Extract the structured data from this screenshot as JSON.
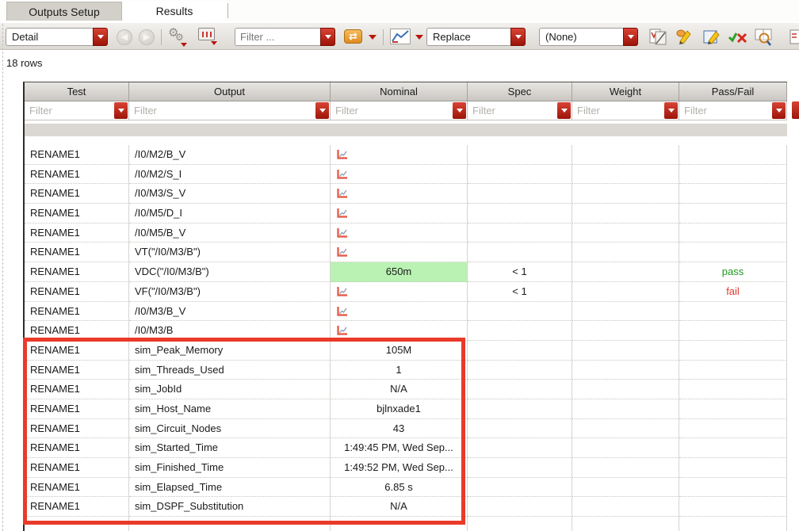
{
  "tabs": [
    {
      "label": "Outputs Setup",
      "active": false
    },
    {
      "label": "Results",
      "active": true
    }
  ],
  "toolbar": {
    "view_mode_combo": {
      "value": "Detail"
    },
    "filter_combo": {
      "placeholder": "Filter ..."
    },
    "plot_mode_combo": {
      "value": "Replace"
    },
    "refinement_combo": {
      "value": "(None)"
    },
    "icons": [
      "back-arrow-icon",
      "forward-arrow-icon",
      "settings-gears-icon",
      "waveform-window-icon",
      "swap-refresh-icon",
      "plot-chart-icon",
      "spec-editor-icon",
      "highlight-pencil-icon",
      "edit-notes-icon",
      "pass-fail-check-icon",
      "find-documents-icon",
      "clipped-document-icon"
    ]
  },
  "status": {
    "row_count_label": "18 rows"
  },
  "table": {
    "columns": [
      "Test",
      "Output",
      "Nominal",
      "Spec",
      "Weight",
      "Pass/Fail"
    ],
    "filter_placeholder": "Filter",
    "rows": [
      {
        "test": "RENAME1",
        "output": "/I0/M2/B_V",
        "nominal_icon": true,
        "nominal_text": "",
        "spec": "",
        "weight": "",
        "passfail": ""
      },
      {
        "test": "RENAME1",
        "output": "/I0/M2/S_I",
        "nominal_icon": true,
        "nominal_text": "",
        "spec": "",
        "weight": "",
        "passfail": ""
      },
      {
        "test": "RENAME1",
        "output": "/I0/M3/S_V",
        "nominal_icon": true,
        "nominal_text": "",
        "spec": "",
        "weight": "",
        "passfail": ""
      },
      {
        "test": "RENAME1",
        "output": "/I0/M5/D_I",
        "nominal_icon": true,
        "nominal_text": "",
        "spec": "",
        "weight": "",
        "passfail": ""
      },
      {
        "test": "RENAME1",
        "output": "/I0/M5/B_V",
        "nominal_icon": true,
        "nominal_text": "",
        "spec": "",
        "weight": "",
        "passfail": ""
      },
      {
        "test": "RENAME1",
        "output": "VT(\"/I0/M3/B\")",
        "nominal_icon": true,
        "nominal_text": "",
        "spec": "",
        "weight": "",
        "passfail": ""
      },
      {
        "test": "RENAME1",
        "output": "VDC(\"/I0/M3/B\")",
        "nominal_icon": false,
        "nominal_text": "650m",
        "nominal_highlight": true,
        "spec": "< 1",
        "weight": "",
        "passfail": "pass"
      },
      {
        "test": "RENAME1",
        "output": "VF(\"/I0/M3/B\")",
        "nominal_icon": true,
        "nominal_text": "",
        "spec": "< 1",
        "weight": "",
        "passfail": "fail"
      },
      {
        "test": "RENAME1",
        "output": "/I0/M3/B_V",
        "nominal_icon": true,
        "nominal_text": "",
        "spec": "",
        "weight": "",
        "passfail": ""
      },
      {
        "test": "RENAME1",
        "output": "/I0/M3/B",
        "nominal_icon": true,
        "nominal_text": "",
        "spec": "",
        "weight": "",
        "passfail": ""
      },
      {
        "test": "RENAME1",
        "output": "sim_Peak_Memory",
        "nominal_icon": false,
        "nominal_text": "105M",
        "spec": "",
        "weight": "",
        "passfail": ""
      },
      {
        "test": "RENAME1",
        "output": "sim_Threads_Used",
        "nominal_icon": false,
        "nominal_text": "1",
        "spec": "",
        "weight": "",
        "passfail": ""
      },
      {
        "test": "RENAME1",
        "output": "sim_JobId",
        "nominal_icon": false,
        "nominal_text": "N/A",
        "spec": "",
        "weight": "",
        "passfail": ""
      },
      {
        "test": "RENAME1",
        "output": "sim_Host_Name",
        "nominal_icon": false,
        "nominal_text": "bjlnxade1",
        "spec": "",
        "weight": "",
        "passfail": ""
      },
      {
        "test": "RENAME1",
        "output": "sim_Circuit_Nodes",
        "nominal_icon": false,
        "nominal_text": "43",
        "spec": "",
        "weight": "",
        "passfail": ""
      },
      {
        "test": "RENAME1",
        "output": "sim_Started_Time",
        "nominal_icon": false,
        "nominal_text": "1:49:45 PM, Wed Sep...",
        "spec": "",
        "weight": "",
        "passfail": ""
      },
      {
        "test": "RENAME1",
        "output": "sim_Finished_Time",
        "nominal_icon": false,
        "nominal_text": "1:49:52 PM, Wed Sep...",
        "spec": "",
        "weight": "",
        "passfail": ""
      },
      {
        "test": "RENAME1",
        "output": "sim_Elapsed_Time",
        "nominal_icon": false,
        "nominal_text": "6.85 s",
        "spec": "",
        "weight": "",
        "passfail": ""
      },
      {
        "test": "RENAME1",
        "output": "sim_DSPF_Substitution",
        "nominal_icon": false,
        "nominal_text": "N/A",
        "spec": "",
        "weight": "",
        "passfail": ""
      }
    ]
  },
  "annotation": {
    "type": "red-highlight-box"
  },
  "colors": {
    "accent_red": "#b01108",
    "pass_green": "#1f9a1f",
    "fail_red": "#e03a2f",
    "nominal_highlight": "#b9f2b2",
    "annotation_red": "#ea3a2a"
  }
}
